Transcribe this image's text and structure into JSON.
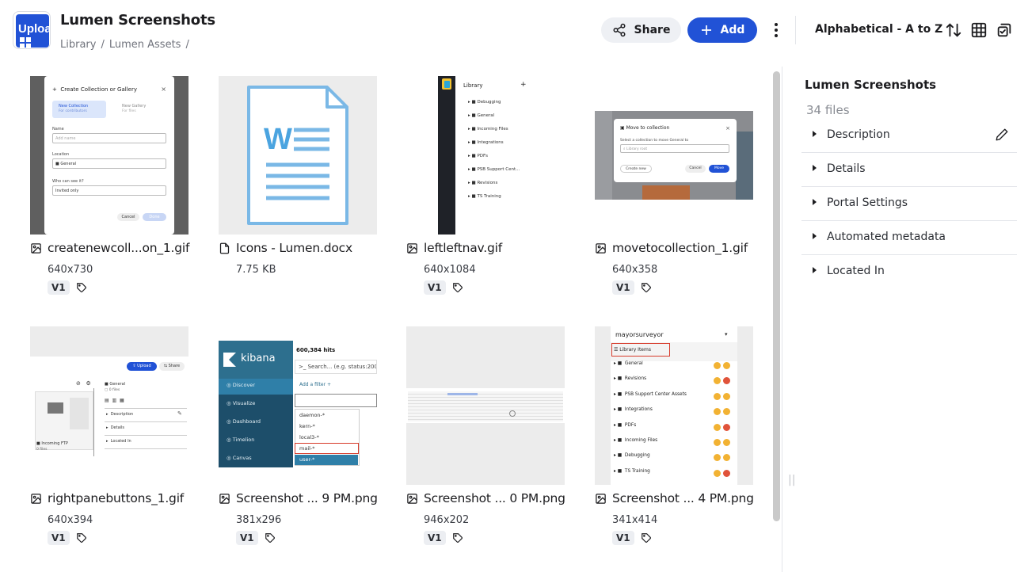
{
  "header": {
    "logo_text": "Uploa",
    "title": "Lumen Screenshots",
    "breadcrumb": [
      "Library",
      "Lumen Assets"
    ],
    "share_label": "Share",
    "add_label": "Add",
    "sort_label": "Alphabetical - A to Z",
    "colors": {
      "accent": "#2152d6",
      "share_bg": "#eef0f4"
    }
  },
  "files": [
    {
      "name": "createnewcoll...on_1.gif",
      "meta": "640x730",
      "version": "V1",
      "icon": "image-icon",
      "preview": {
        "title": "Create Collection or Gallery",
        "opt_collection": "New Collection",
        "opt_collection_sub": "For contributors",
        "opt_gallery": "New Gallery",
        "opt_gallery_sub": "For files",
        "name_label": "Name",
        "name_placeholder": "Add name",
        "location_label": "Location",
        "location_value": "General",
        "who_label": "Who can see it?",
        "who_value": "Invited only",
        "cancel": "Cancel",
        "done": "Done"
      }
    },
    {
      "name": "Icons - Lumen.docx",
      "meta": "7.75 KB",
      "version": "",
      "icon": "document-icon",
      "preview": {
        "letter": "W"
      }
    },
    {
      "name": "leftleftnav.gif",
      "meta": "640x1084",
      "version": "V1",
      "icon": "image-icon",
      "preview": {
        "title": "Library",
        "items": [
          "Debugging",
          "General",
          "Incoming Files",
          "Integrations",
          "PDFs",
          "PSB Support Cent...",
          "Revisions",
          "TS Training"
        ]
      }
    },
    {
      "name": "movetocollection_1.gif",
      "meta": "640x358",
      "version": "V1",
      "icon": "image-icon",
      "preview": {
        "title": "Move to collection",
        "desc": "Select a collection to move General to",
        "placeholder": "Library root",
        "create": "Create new",
        "cancel": "Cancel",
        "move": "Move"
      }
    },
    {
      "name": "rightpanebuttons_1.gif",
      "meta": "640x394",
      "version": "V1",
      "icon": "image-icon",
      "preview": {
        "upload": "Upload",
        "share": "Share",
        "general": "General",
        "files": "0 files",
        "incoming": "Incoming FTP",
        "incoming_files": "0 files",
        "rows": [
          "Description",
          "Details",
          "Located In"
        ]
      }
    },
    {
      "name": "Screenshot ... 9 PM.png",
      "meta": "381x296",
      "version": "V1",
      "icon": "image-icon",
      "preview": {
        "brand": "kibana",
        "hits": "600,384 hits",
        "search": "Search... (e.g. status:200",
        "add_filter": "Add a filter",
        "nav": [
          "Discover",
          "Visualize",
          "Dashboard",
          "Timelion",
          "Canvas"
        ],
        "options": [
          "daemon-*",
          "kern-*",
          "local3-*",
          "mail-*",
          "user-*"
        ]
      }
    },
    {
      "name": "Screenshot ... 0 PM.png",
      "meta": "946x202",
      "version": "V1",
      "icon": "image-icon",
      "preview": {}
    },
    {
      "name": "Screenshot ... 4 PM.png",
      "meta": "341x414",
      "version": "V1",
      "icon": "image-icon",
      "preview": {
        "user": "mayorsurveyor",
        "library_items": "Library Items",
        "items": [
          "General",
          "Revisions",
          "PSB Support Center Assets",
          "Integrations",
          "PDFs",
          "Incoming Files",
          "Debugging",
          "TS Training"
        ]
      }
    }
  ],
  "panel": {
    "title": "Lumen Screenshots",
    "count": "34 files",
    "sections": [
      "Description",
      "Details",
      "Portal Settings",
      "Automated metadata",
      "Located In"
    ]
  }
}
